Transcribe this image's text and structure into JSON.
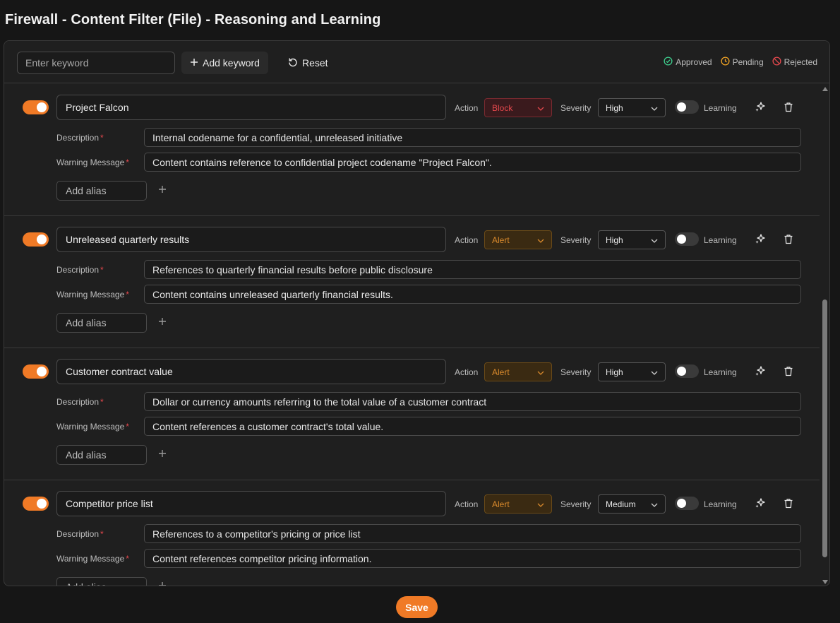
{
  "page": {
    "title": "Firewall - Content Filter (File) - Reasoning and Learning"
  },
  "toolbar": {
    "keyword_placeholder": "Enter keyword",
    "add_keyword_label": "Add keyword",
    "reset_label": "Reset",
    "legend": [
      {
        "label": "Approved",
        "color": "#3ecf8e",
        "icon": "check-circle-icon"
      },
      {
        "label": "Pending",
        "color": "#f5a524",
        "icon": "clock-icon"
      },
      {
        "label": "Rejected",
        "color": "#e5484d",
        "icon": "ban-icon"
      }
    ]
  },
  "labels": {
    "action": "Action",
    "severity": "Severity",
    "learning": "Learning",
    "description": "Description",
    "warning": "Warning Message",
    "required_mark": "*",
    "add_alias": "Add alias"
  },
  "keywords": [
    {
      "enabled": true,
      "name": "Project Falcon",
      "action": "Block",
      "severity": "High",
      "learning": false,
      "description": "Internal codename for a confidential, unreleased initiative",
      "warning": "Content contains reference to confidential project codename \"Project Falcon\"."
    },
    {
      "enabled": true,
      "name": "Unreleased quarterly results",
      "action": "Alert",
      "severity": "High",
      "learning": false,
      "description": "References to quarterly financial results before public disclosure",
      "warning": "Content contains unreleased quarterly financial results."
    },
    {
      "enabled": true,
      "name": "Customer contract value",
      "action": "Alert",
      "severity": "High",
      "learning": false,
      "description": "Dollar or currency amounts referring to the total value of a customer contract",
      "warning": "Content references a customer contract's total value."
    },
    {
      "enabled": true,
      "name": "Competitor price list",
      "action": "Alert",
      "severity": "Medium",
      "learning": false,
      "description": "References to a competitor's pricing or price list",
      "warning": "Content references competitor pricing information."
    }
  ],
  "footer": {
    "save_label": "Save"
  },
  "colors": {
    "accent": "#f07a26",
    "block": "#e5484d",
    "alert": "#d8892c"
  }
}
